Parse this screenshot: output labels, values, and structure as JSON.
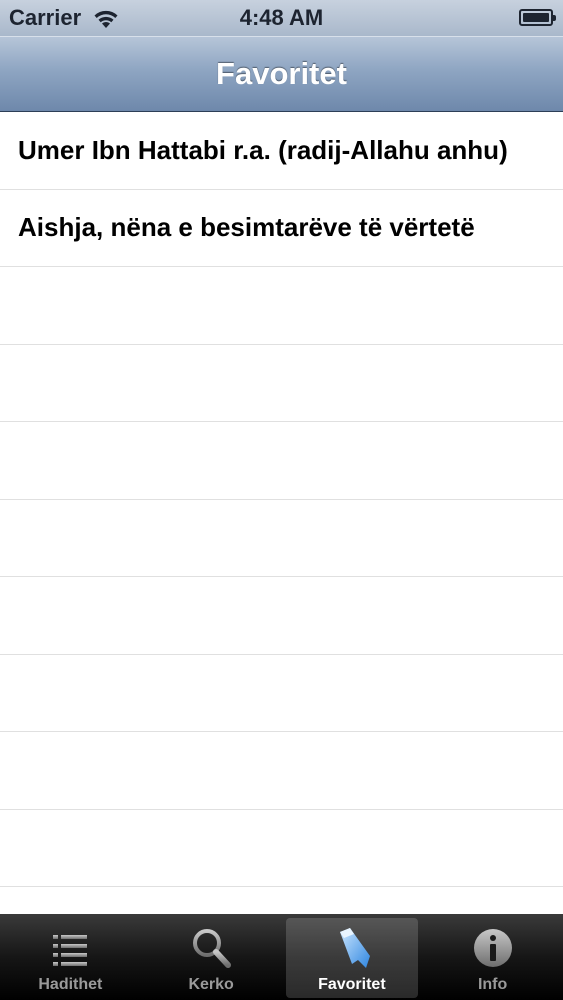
{
  "status_bar": {
    "carrier": "Carrier",
    "time": "4:48 AM"
  },
  "nav_bar": {
    "title": "Favoritet"
  },
  "list": {
    "items": [
      {
        "label": "Umer Ibn Hattabi r.a. (radij-Allahu anhu)"
      },
      {
        "label": "Aishja, nëna e besimtarëve të vërtetë"
      }
    ]
  },
  "tab_bar": {
    "tabs": [
      {
        "label": "Hadithet",
        "icon": "list-icon"
      },
      {
        "label": "Kerko",
        "icon": "search-icon"
      },
      {
        "label": "Favoritet",
        "icon": "bookmark-icon",
        "selected": true
      },
      {
        "label": "Info",
        "icon": "info-icon"
      }
    ]
  },
  "colors": {
    "nav_bar": "#7f97b8",
    "tab_bar": "#161616",
    "selected_icon": "#5aa8f0"
  }
}
